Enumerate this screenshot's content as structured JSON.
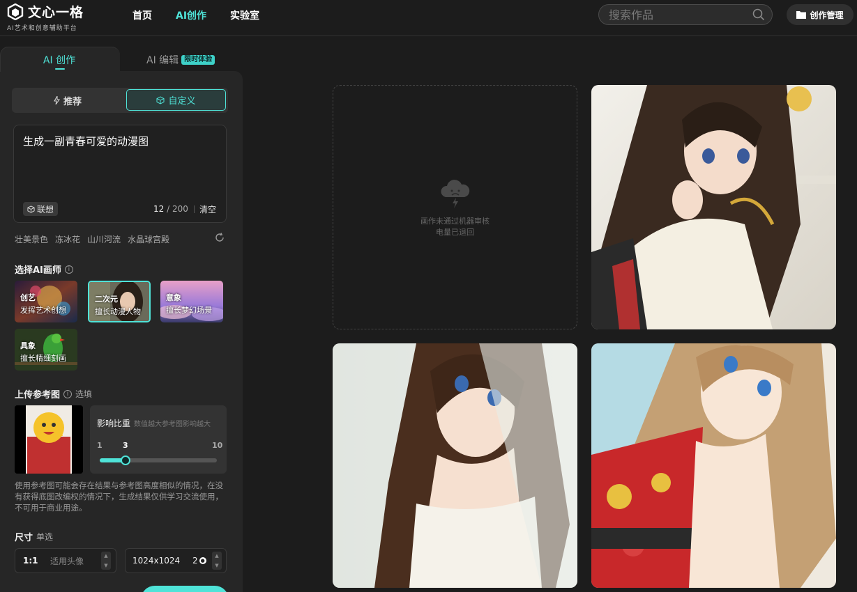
{
  "header": {
    "logo_name": "文心一格",
    "logo_sub": "AI艺术和创意辅助平台",
    "nav": [
      "首页",
      "AI创作",
      "实验室"
    ],
    "active_nav": "AI创作",
    "search_placeholder": "搜索作品",
    "manage_label": "创作管理"
  },
  "panel": {
    "tab_create": "AI 创作",
    "tab_edit": "AI 编辑",
    "tab_edit_badge": "限时体验",
    "mode_recommend": "推荐",
    "mode_custom": "自定义",
    "prompt_text": "生成一副青春可爱的动漫图",
    "assoc_label": "联想",
    "count_current": "12",
    "count_max": "/ 200",
    "clear_label": "清空",
    "tags": [
      "壮美景色",
      "冻冰花",
      "山川河流",
      "水晶球宫殿"
    ],
    "artist_title": "选择AI画师",
    "artists": [
      {
        "name": "创艺",
        "desc": "发挥艺术创想"
      },
      {
        "name": "二次元",
        "desc": "擅长动漫人物"
      },
      {
        "name": "意象",
        "desc": "擅长梦幻场景"
      },
      {
        "name": "具象",
        "desc": "擅长精细刻画"
      }
    ],
    "selected_artist": "二次元",
    "ref_title": "上传参考图",
    "ref_optional": "选填",
    "influence_title": "影响比重",
    "influence_hint": "数值越大参考图影响越大",
    "influence_min": "1",
    "influence_value": "3",
    "influence_max": "10",
    "disclaimer": "使用参考图可能会存在结果与参考图高度相似的情况，在没有获得底图改编权的情况下，生成结果仅供学习交流使用，不可用于商业用途。",
    "size_title": "尺寸",
    "size_single": "单选",
    "size_ratio": "1:1",
    "size_use": "适用头像",
    "size_dim": "1024x1024",
    "size_count": "2"
  },
  "gallery": {
    "failed_line1": "画作未通过机器审核",
    "failed_line2": "电量已退回"
  },
  "colors": {
    "accent": "#4fe3d8",
    "background": "#1c1c1c",
    "panel": "#262626"
  }
}
